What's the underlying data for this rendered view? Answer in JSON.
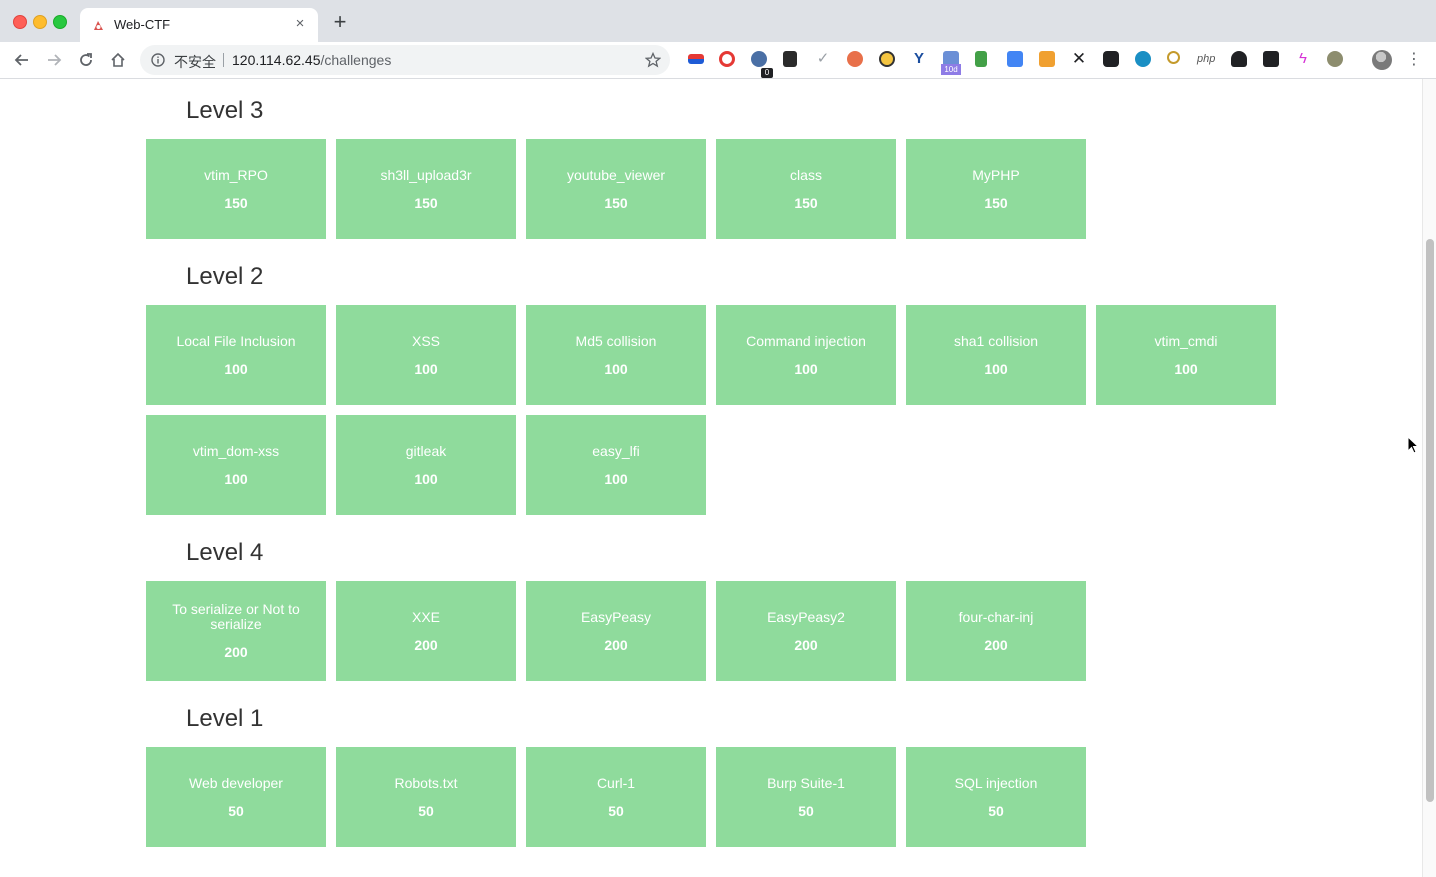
{
  "browser": {
    "tab_title": "Web-CTF",
    "tab_close": "×",
    "new_tab": "+",
    "security_label": "不安全",
    "url_host": "120.114.62.45",
    "url_path": "/challenges",
    "extension_badge": "0",
    "extension_badge_2": "10d",
    "menu": "⋮"
  },
  "levels": [
    {
      "title": "Level 3",
      "challenges": [
        {
          "name": "vtim_RPO",
          "points": "150"
        },
        {
          "name": "sh3ll_upload3r",
          "points": "150"
        },
        {
          "name": "youtube_viewer",
          "points": "150"
        },
        {
          "name": "class",
          "points": "150"
        },
        {
          "name": "MyPHP",
          "points": "150"
        }
      ]
    },
    {
      "title": "Level 2",
      "challenges": [
        {
          "name": "Local File Inclusion",
          "points": "100"
        },
        {
          "name": "XSS",
          "points": "100"
        },
        {
          "name": "Md5 collision",
          "points": "100"
        },
        {
          "name": "Command injection",
          "points": "100"
        },
        {
          "name": "sha1 collision",
          "points": "100"
        },
        {
          "name": "vtim_cmdi",
          "points": "100"
        },
        {
          "name": "vtim_dom-xss",
          "points": "100"
        },
        {
          "name": "gitleak",
          "points": "100"
        },
        {
          "name": "easy_lfi",
          "points": "100"
        }
      ]
    },
    {
      "title": "Level 4",
      "challenges": [
        {
          "name": "To serialize or Not to serialize",
          "points": "200"
        },
        {
          "name": "XXE",
          "points": "200"
        },
        {
          "name": "EasyPeasy",
          "points": "200"
        },
        {
          "name": "EasyPeasy2",
          "points": "200"
        },
        {
          "name": "four-char-inj",
          "points": "200"
        }
      ]
    },
    {
      "title": "Level 1",
      "challenges": [
        {
          "name": "Web developer",
          "points": "50"
        },
        {
          "name": "Robots.txt",
          "points": "50"
        },
        {
          "name": "Curl-1",
          "points": "50"
        },
        {
          "name": "Burp Suite-1",
          "points": "50"
        },
        {
          "name": "SQL injection",
          "points": "50"
        }
      ]
    }
  ],
  "colors": {
    "card_background": "#8fdb9c",
    "card_text": "#ffffff",
    "level_title": "#333333"
  }
}
